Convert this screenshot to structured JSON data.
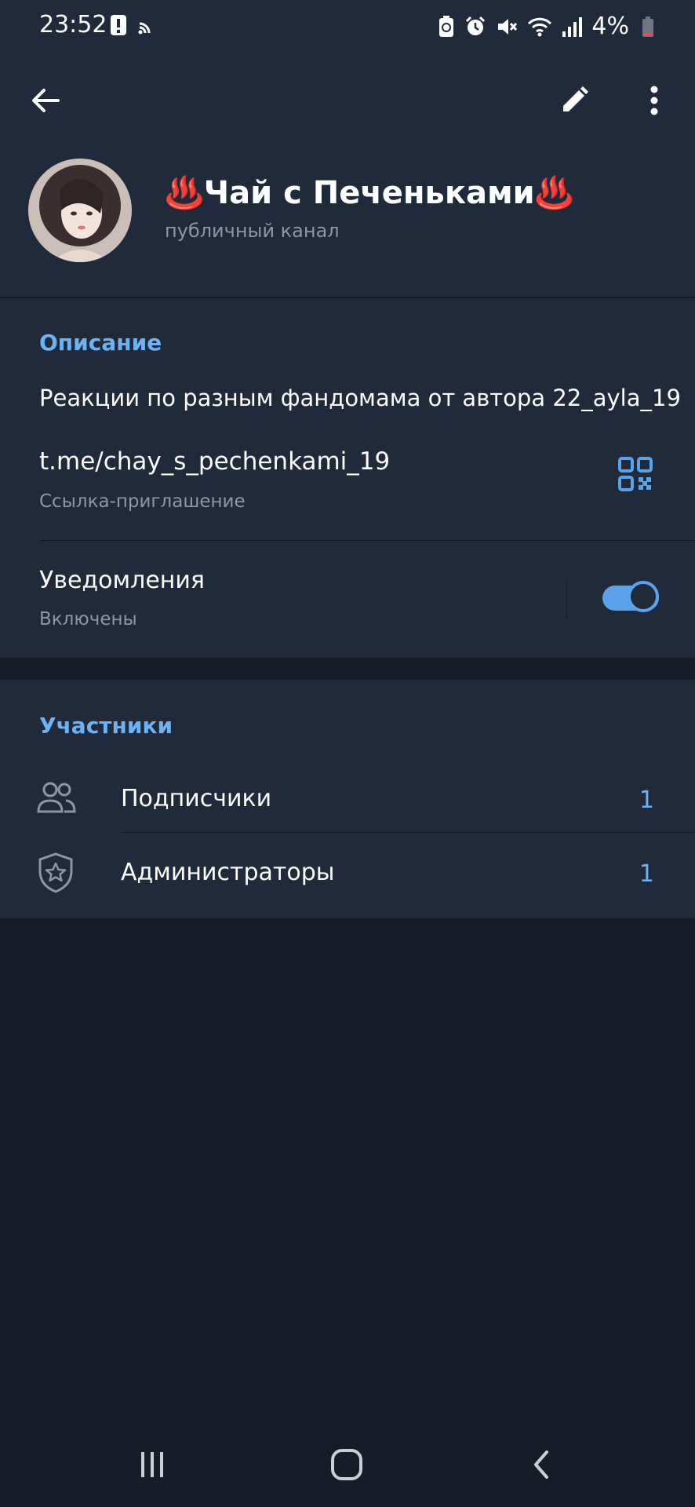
{
  "status_bar": {
    "time": "23:52",
    "battery": "4%"
  },
  "channel": {
    "name": "♨️Чай с Печеньками♨️",
    "type": "публичный канал"
  },
  "info": {
    "title": "Описание",
    "description": "Реакции по разным фандомама от автора 22_ayla_19",
    "link": "t.me/chay_s_pechenkami_19",
    "link_caption": "Ссылка-приглашение",
    "notifications_label": "Уведомления",
    "notifications_status": "Включены",
    "notifications_on": true
  },
  "members": {
    "title": "Участники",
    "rows": [
      {
        "label": "Подписчики",
        "count": "1",
        "icon": "people-icon"
      },
      {
        "label": "Администраторы",
        "count": "1",
        "icon": "shield-star-icon"
      }
    ]
  },
  "colors": {
    "accent": "#6cb3f5",
    "background": "#161c28",
    "panel": "#212a3b"
  }
}
